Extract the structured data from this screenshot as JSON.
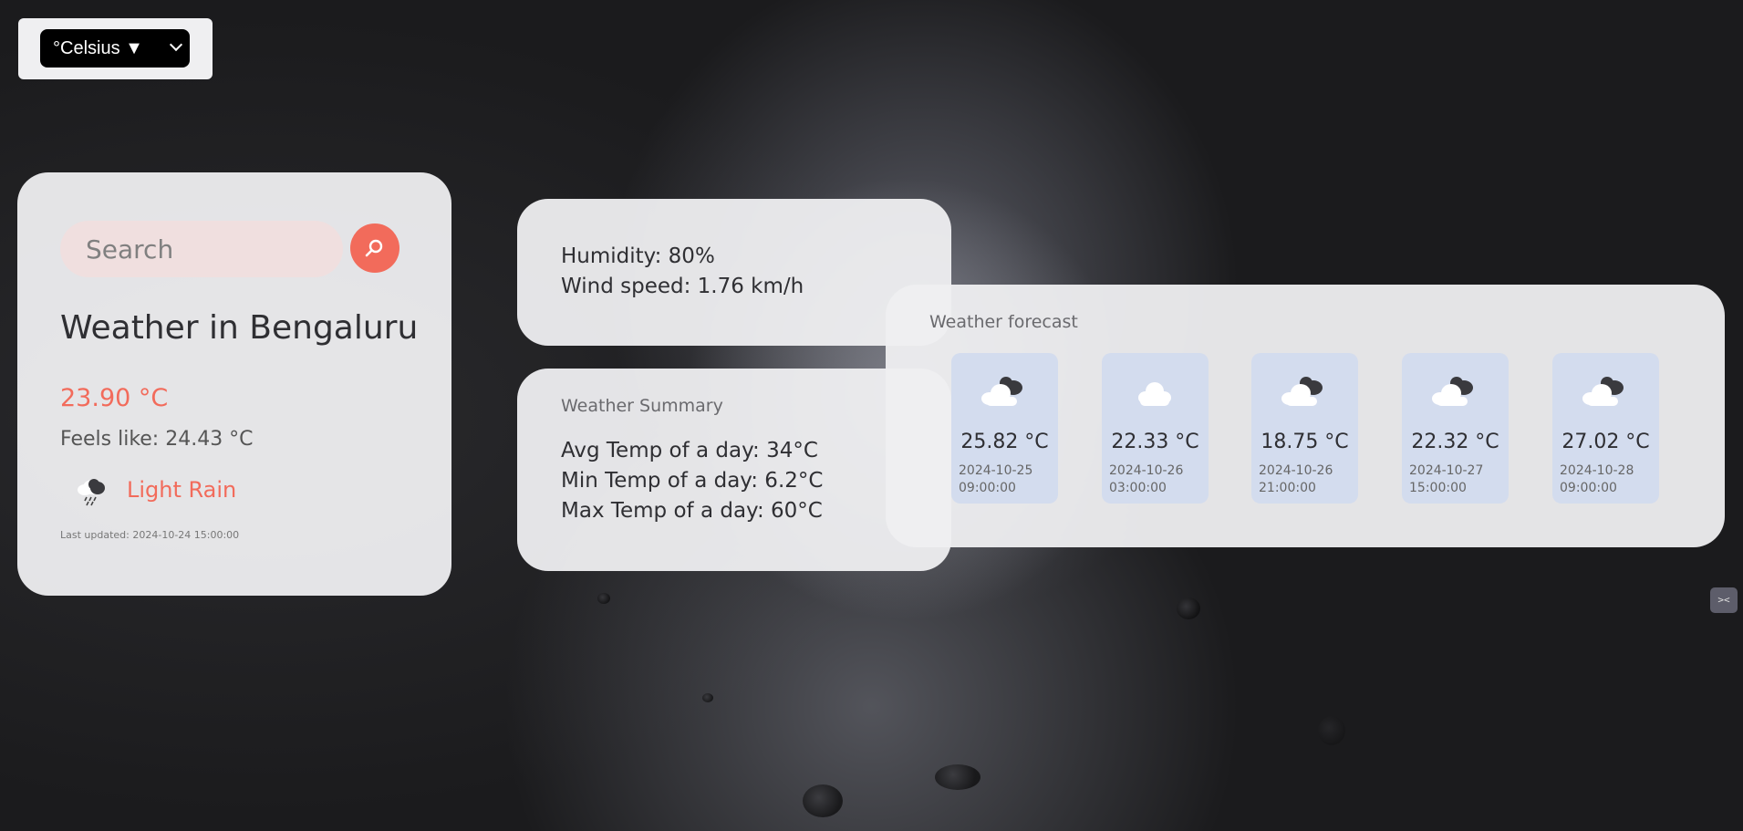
{
  "unit_selector": {
    "value": "°Celsius ▼"
  },
  "search": {
    "placeholder": "Search"
  },
  "current": {
    "city_title": "Weather in Bengaluru",
    "temperature": "23.90 °C",
    "feels_like": "Feels like: 24.43 °C",
    "condition": "Light Rain",
    "condition_icon": "light-rain-icon",
    "last_updated": "Last updated: 2024-10-24 15:00:00"
  },
  "details": {
    "humidity": "Humidity: 80%",
    "wind_speed": "Wind speed: 1.76 km/h"
  },
  "summary": {
    "title": "Weather Summary",
    "avg": "Avg Temp of a day: 34°C",
    "min": "Min Temp of a day: 6.2°C",
    "max": "Max Temp of a day: 60°C"
  },
  "forecast": {
    "title": "Weather forecast",
    "items": [
      {
        "temp": "25.82 °C",
        "date": "2024-10-25",
        "time": "09:00:00",
        "icon": "partly-cloudy-icon"
      },
      {
        "temp": "22.33 °C",
        "date": "2024-10-26",
        "time": "03:00:00",
        "icon": "cloud-icon"
      },
      {
        "temp": "18.75 °C",
        "date": "2024-10-26",
        "time": "21:00:00",
        "icon": "partly-cloudy-icon"
      },
      {
        "temp": "22.32 °C",
        "date": "2024-10-27",
        "time": "15:00:00",
        "icon": "partly-cloudy-icon"
      },
      {
        "temp": "27.02 °C",
        "date": "2024-10-28",
        "time": "09:00:00",
        "icon": "partly-cloudy-icon"
      }
    ]
  },
  "colors": {
    "accent": "#f26b5b",
    "card_bg": "#efeff1",
    "forecast_tile": "#d3dcee"
  }
}
